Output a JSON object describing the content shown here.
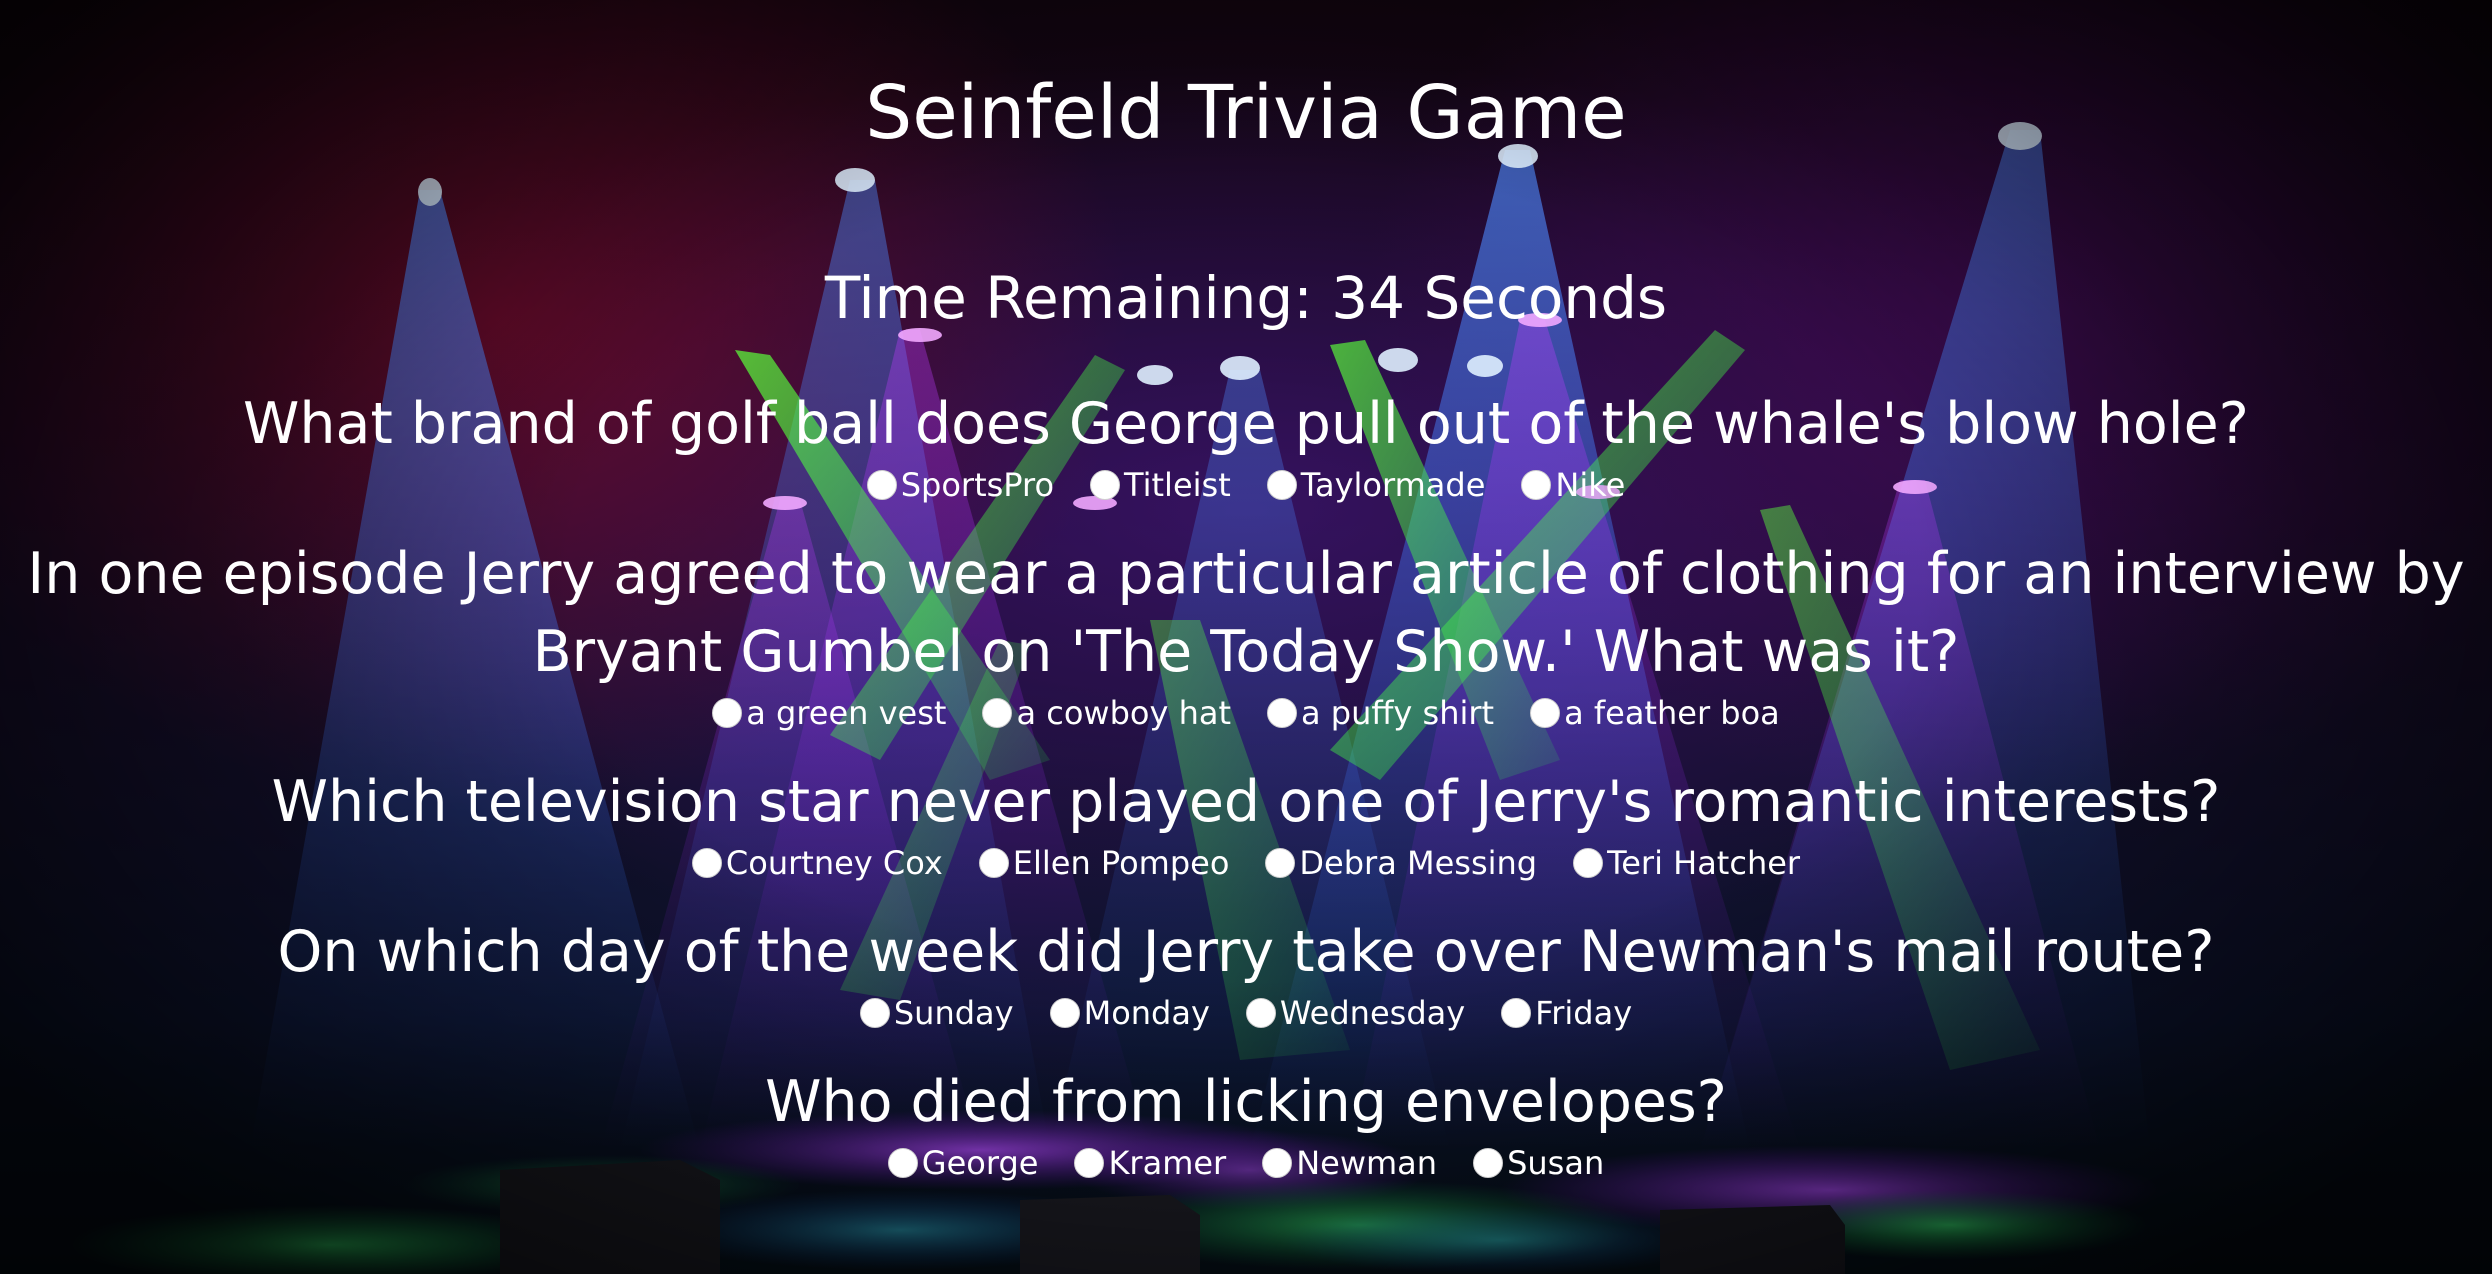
{
  "page": {
    "title": "Seinfeld Trivia Game",
    "timer_text": "Time Remaining: 34 Seconds"
  },
  "questions": [
    {
      "text": "What brand of golf ball does George pull out of the whale's blow hole?",
      "answers": [
        "SportsPro",
        "Titleist",
        "Taylormade",
        "Nike"
      ]
    },
    {
      "text": "In one episode Jerry agreed to wear a particular article of clothing for an interview by Bryant Gumbel on 'The Today Show.' What was it?",
      "answers": [
        "a green vest",
        "a cowboy hat",
        "a puffy shirt",
        "a feather boa"
      ]
    },
    {
      "text": "Which television star never played one of Jerry's romantic interests?",
      "answers": [
        "Courtney Cox",
        "Ellen Pompeo",
        "Debra Messing",
        "Teri Hatcher"
      ]
    },
    {
      "text": "On which day of the week did Jerry take over Newman's mail route?",
      "answers": [
        "Sunday",
        "Monday",
        "Wednesday",
        "Friday"
      ]
    },
    {
      "text": "Who died from licking envelopes?",
      "answers": [
        "George",
        "Kramer",
        "Newman",
        "Susan"
      ]
    }
  ],
  "colors": {
    "text": "#ffffff",
    "beam_green": "#39ff3a",
    "beam_blue": "#2f6bff",
    "beam_purple": "#c03cff",
    "stage_floor_purple": "#9a2cff",
    "stage_floor_green": "#2cff6a"
  },
  "icons": {
    "answer_marker": "radio-button-icon"
  }
}
